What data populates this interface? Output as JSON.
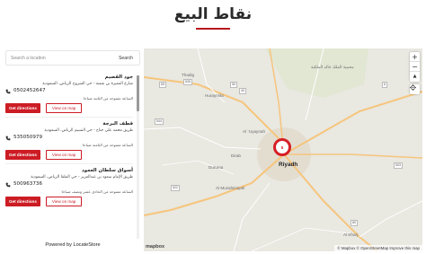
{
  "page": {
    "title": "نقاط البيع"
  },
  "search": {
    "placeholder": "Search a location",
    "button_label": "Search"
  },
  "stores": [
    {
      "name": "جود القصيم",
      "address": "شارع المغيرة بن شعبة - حي الشروخ الرياض، السعودية",
      "phone": "0502452647",
      "hours": "الساعة مفتوحة من الثانية صباحا",
      "directions_label": "Get directions",
      "map_label": "View on map"
    },
    {
      "name": "قطف البرجة",
      "address": "طريق محمد علي جناح - حي النسيم الرياض، السعودية",
      "phone": "535050979",
      "hours": "الساعة مفتوحة من الثامنة صباحا",
      "directions_label": "Get directions",
      "map_label": "View on map"
    },
    {
      "name": "أسواق سلطان العمود",
      "address": "طريق الإمام سعود بن عبدالعزيز - حي الملقا الرياض، السعودية",
      "phone": "500963736",
      "hours": "الساعة مفتوحة من الحادي عشر ونصف صباحا",
      "directions_label": "Get directions",
      "map_label": "View on map"
    }
  ],
  "footer": {
    "powered_by": "Powered by LocateStore"
  },
  "map": {
    "cluster_count": "5",
    "labels": {
      "thadiq": "Thadig",
      "huraymila": "Huraymila",
      "al_uyaynah": "Al `Uyaynah",
      "dirab": "Dirab",
      "duruma": "Duruma",
      "al_muzahimiyah": "Al Muzahimiyah",
      "riyadh": "Riyadh",
      "al_kharj": "Al Kharj",
      "reserve": "محمية الملك خالد الملكية"
    },
    "roads": [
      "50",
      "40",
      "65",
      "535",
      "544",
      "6",
      "503",
      "80",
      "522"
    ],
    "zoom_in": "+",
    "zoom_out": "−",
    "compass": "▲",
    "logo": "mapbox",
    "attribution": "© Mapbox © OpenStreetMap Improve this map"
  },
  "colors": {
    "accent": "#cc1c24",
    "map_land": "#e9e8e1",
    "map_road": "#f6c57c"
  }
}
